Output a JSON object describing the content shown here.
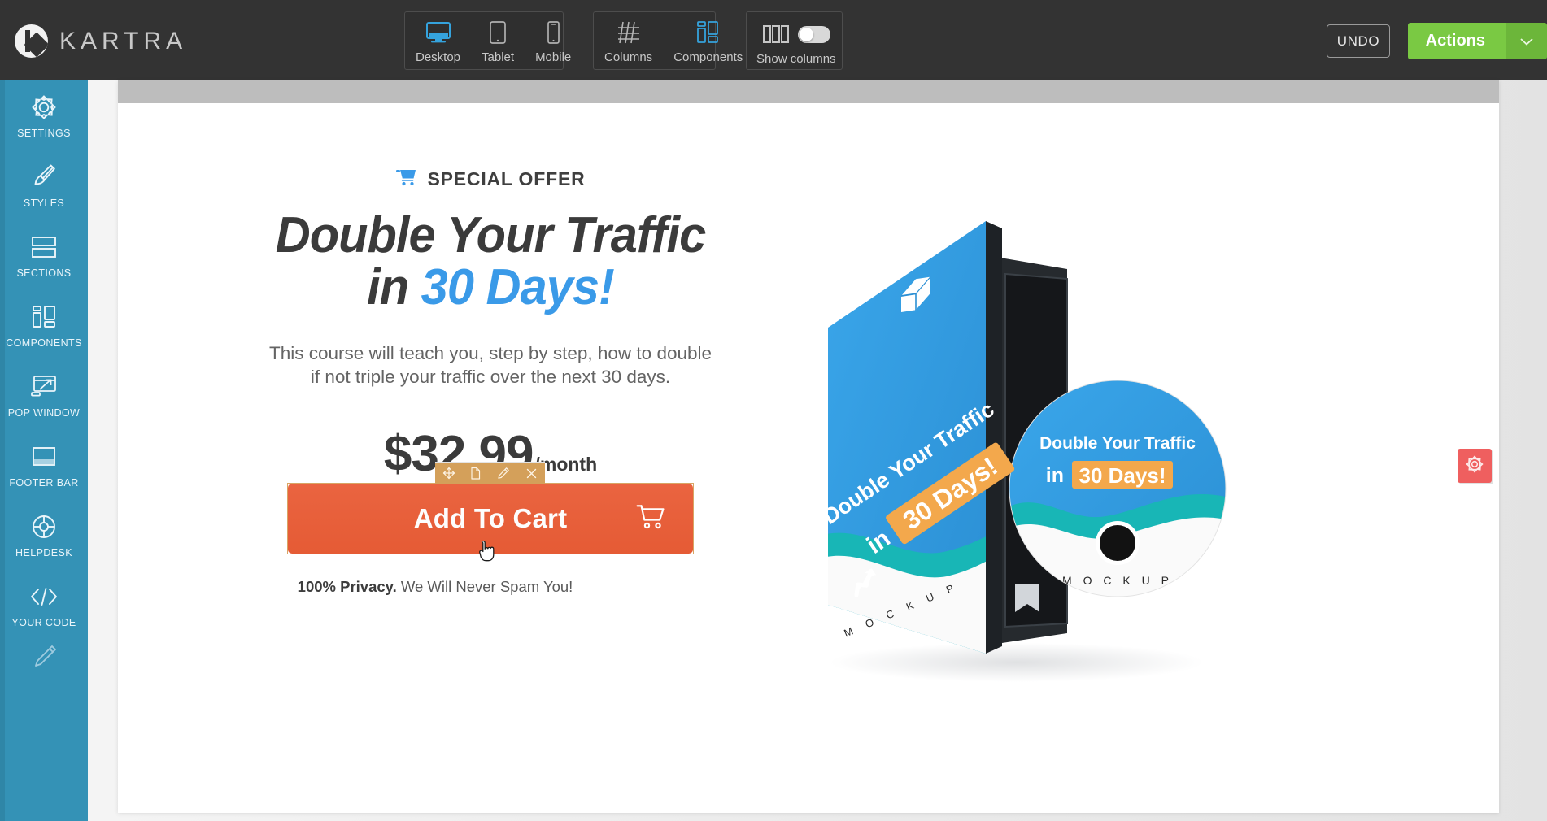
{
  "app": {
    "brand": "KARTRA"
  },
  "toolbar": {
    "devices": {
      "group_name": "device-preview",
      "items": [
        {
          "label": "Desktop",
          "icon": "desktop-icon",
          "active": true
        },
        {
          "label": "Tablet",
          "icon": "tablet-icon",
          "active": false
        },
        {
          "label": "Mobile",
          "icon": "mobile-icon",
          "active": false
        }
      ]
    },
    "structure": {
      "items": [
        {
          "label": "Columns",
          "icon": "grid-icon",
          "active": false
        },
        {
          "label": "Components",
          "icon": "components-icon",
          "active": true
        }
      ]
    },
    "show_columns": {
      "label": "Show columns",
      "icon": "columns-icon",
      "toggle_on": false
    },
    "undo_label": "UNDO",
    "actions_label": "Actions",
    "actions_caret_icon": "chevron-down-icon",
    "accent_green": "#7ac943",
    "accent_blue": "#35a3dd"
  },
  "sidebar": {
    "items": [
      {
        "label": "SETTINGS",
        "icon": "gear-icon"
      },
      {
        "label": "STYLES",
        "icon": "paintbrush-icon"
      },
      {
        "label": "SECTIONS",
        "icon": "sections-icon"
      },
      {
        "label": "COMPONENTS",
        "icon": "components-icon"
      },
      {
        "label": "POP WINDOW",
        "icon": "popup-window-icon"
      },
      {
        "label": "FOOTER BAR",
        "icon": "footer-bar-icon"
      },
      {
        "label": "HELPDESK",
        "icon": "lifebuoy-icon"
      },
      {
        "label": "YOUR CODE",
        "icon": "code-icon"
      },
      {
        "label": "",
        "icon": "pencil-icon"
      }
    ],
    "background_color": "#3492b6"
  },
  "canvas": {
    "settings_tab_icon": "gear-icon",
    "settings_tab_color": "#ef5f5f"
  },
  "page": {
    "offer_badge": {
      "icon": "shopping-cart-icon",
      "text": "SPECIAL OFFER"
    },
    "headline_line1": "Double Your Traffic",
    "headline_line2_prefix": "in ",
    "headline_line2_accent": "30 Days!",
    "headline_accent_color": "#3a9ae8",
    "subcopy_line1": "This course will teach you, step by step, how to double",
    "subcopy_line2": "if not triple your traffic over the next 30 days.",
    "price": "$32,99",
    "price_period": "/month",
    "cta_label": "Add To Cart",
    "cta_icon": "shopping-cart-icon",
    "cta_color": "#e8603c",
    "privacy_bold": "100% Privacy.",
    "privacy_rest": " We Will Never Spam You!"
  },
  "element_toolbar": {
    "tools": [
      {
        "name": "move",
        "icon": "move-arrows-icon"
      },
      {
        "name": "duplicate",
        "icon": "duplicate-page-icon"
      },
      {
        "name": "edit",
        "icon": "pencil-icon"
      },
      {
        "name": "delete",
        "icon": "close-x-icon"
      }
    ],
    "background_color": "#d4a05a"
  },
  "mockup": {
    "box_title_line1": "Double Your Traffic",
    "box_title_line2_prefix": "in ",
    "box_title_line2_highlight": "30 Days!",
    "box_caption": "M O C K U P",
    "disc_title_line1": "Double Your Traffic",
    "disc_title_line2_prefix": "in ",
    "disc_title_line2_highlight": "30 Days!",
    "disc_caption": "M O C K U P",
    "box_icon": "cube-icon",
    "arrow_icon": "trending-up-icon",
    "blue": "#2f9ae0",
    "teal": "#18b6b6",
    "highlight": "#f3a84c"
  }
}
